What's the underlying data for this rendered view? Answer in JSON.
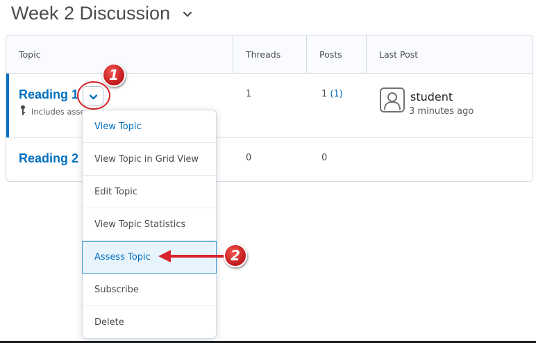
{
  "page": {
    "title": "Week 2 Discussion"
  },
  "table": {
    "headers": {
      "topic": "Topic",
      "threads": "Threads",
      "posts": "Posts",
      "last_post": "Last Post"
    },
    "rows": [
      {
        "topic": "Reading 1",
        "subline": "Includes assessment",
        "threads": "1",
        "posts": "1",
        "posts_unread": "(1)",
        "last_post_user": "student",
        "last_post_time": "3 minutes ago"
      },
      {
        "topic": "Reading 2",
        "threads": "0",
        "posts": "0"
      }
    ]
  },
  "menu": {
    "items": [
      {
        "label": "View Topic"
      },
      {
        "label": "View Topic in Grid View"
      },
      {
        "label": "Edit Topic"
      },
      {
        "label": "View Topic Statistics"
      },
      {
        "label": "Assess Topic",
        "highlighted": true
      },
      {
        "label": "Subscribe"
      },
      {
        "label": "Delete"
      }
    ]
  },
  "annotations": {
    "step1": "1",
    "step2": "2"
  },
  "colors": {
    "link": "#006fbf",
    "border": "#d3d9e3",
    "annotation": "#d8232a",
    "highlight_bg": "#e8f4fb"
  }
}
